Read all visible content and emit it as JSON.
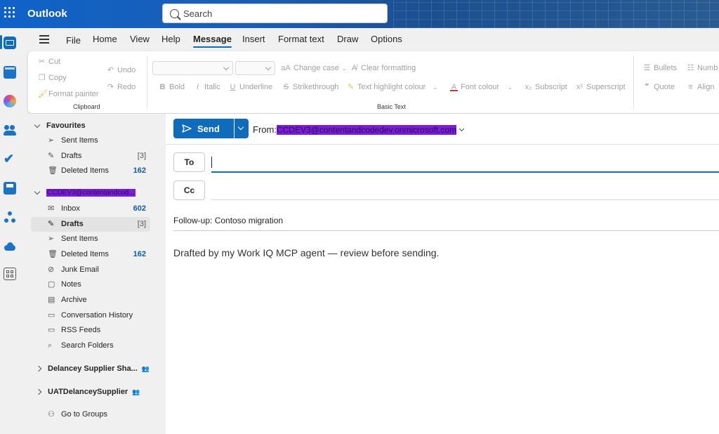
{
  "app": {
    "title": "Outlook"
  },
  "search": {
    "placeholder": "Search"
  },
  "rail": {
    "apps": [
      "mail-icon",
      "calendar-icon",
      "copilot-icon",
      "people-icon",
      "todo-icon",
      "onedrive-save-icon",
      "org-explorer-icon",
      "onedrive-icon",
      "more-apps-icon"
    ]
  },
  "menu": {
    "tabs": [
      {
        "label": "File"
      },
      {
        "label": "Home"
      },
      {
        "label": "View"
      },
      {
        "label": "Help"
      },
      {
        "label": "Message"
      },
      {
        "label": "Insert"
      },
      {
        "label": "Format text"
      },
      {
        "label": "Draw"
      },
      {
        "label": "Options"
      }
    ],
    "active": "Message"
  },
  "ribbon": {
    "clipboard": {
      "cut": "Cut",
      "copy": "Copy",
      "format_painter": "Format painter",
      "undo": "Undo",
      "redo": "Redo",
      "label": "Clipboard"
    },
    "basic_text": {
      "change_case": "Change case",
      "clear_formatting": "Clear formatting",
      "bold": "Bold",
      "italic": "Italic",
      "underline": "Underline",
      "strikethrough": "Strikethrough",
      "highlight": "Text highlight colour",
      "font_colour": "Font colour",
      "subscript": "Subscript",
      "superscript": "Superscript",
      "label": "Basic Text"
    },
    "paragraph": {
      "bullets": "Bullets",
      "numbering": "Numb",
      "quote": "Quote",
      "align": "Align"
    }
  },
  "folders": {
    "favourites": {
      "label": "Favourites",
      "items": [
        {
          "label": "Sent Items",
          "count": ""
        },
        {
          "label": "Drafts",
          "count": "[3]"
        },
        {
          "label": "Deleted Items",
          "count": "162"
        }
      ]
    },
    "account": {
      "label": "CCDEV3@contentandcod...",
      "items": [
        {
          "label": "Inbox",
          "count": "602"
        },
        {
          "label": "Drafts",
          "count": "[3]"
        },
        {
          "label": "Sent Items",
          "count": ""
        },
        {
          "label": "Deleted Items",
          "count": "162"
        },
        {
          "label": "Junk Email",
          "count": ""
        },
        {
          "label": "Notes",
          "count": ""
        },
        {
          "label": "Archive",
          "count": ""
        },
        {
          "label": "Conversation History",
          "count": ""
        },
        {
          "label": "RSS Feeds",
          "count": ""
        },
        {
          "label": "Search Folders",
          "count": ""
        }
      ]
    },
    "groups": [
      {
        "label": "Delancey Supplier Sha..."
      },
      {
        "label": "UATDelanceySupplier"
      }
    ],
    "go_to_groups": "Go to Groups"
  },
  "compose": {
    "send_label": "Send",
    "from_label": "From:",
    "from_address": "CCDEV3@contentandcodedev.onmicrosoft.com",
    "to_label": "To",
    "cc_label": "Cc",
    "subject": "Follow-up: Contoso migration",
    "body": "Drafted by my Work IQ MCP agent — review before sending."
  },
  "colors": {
    "accent": "#0f6cbd",
    "topbar": "#1a5fb4",
    "count": "#0f5aa8",
    "redaction": "#7a1fd6"
  }
}
